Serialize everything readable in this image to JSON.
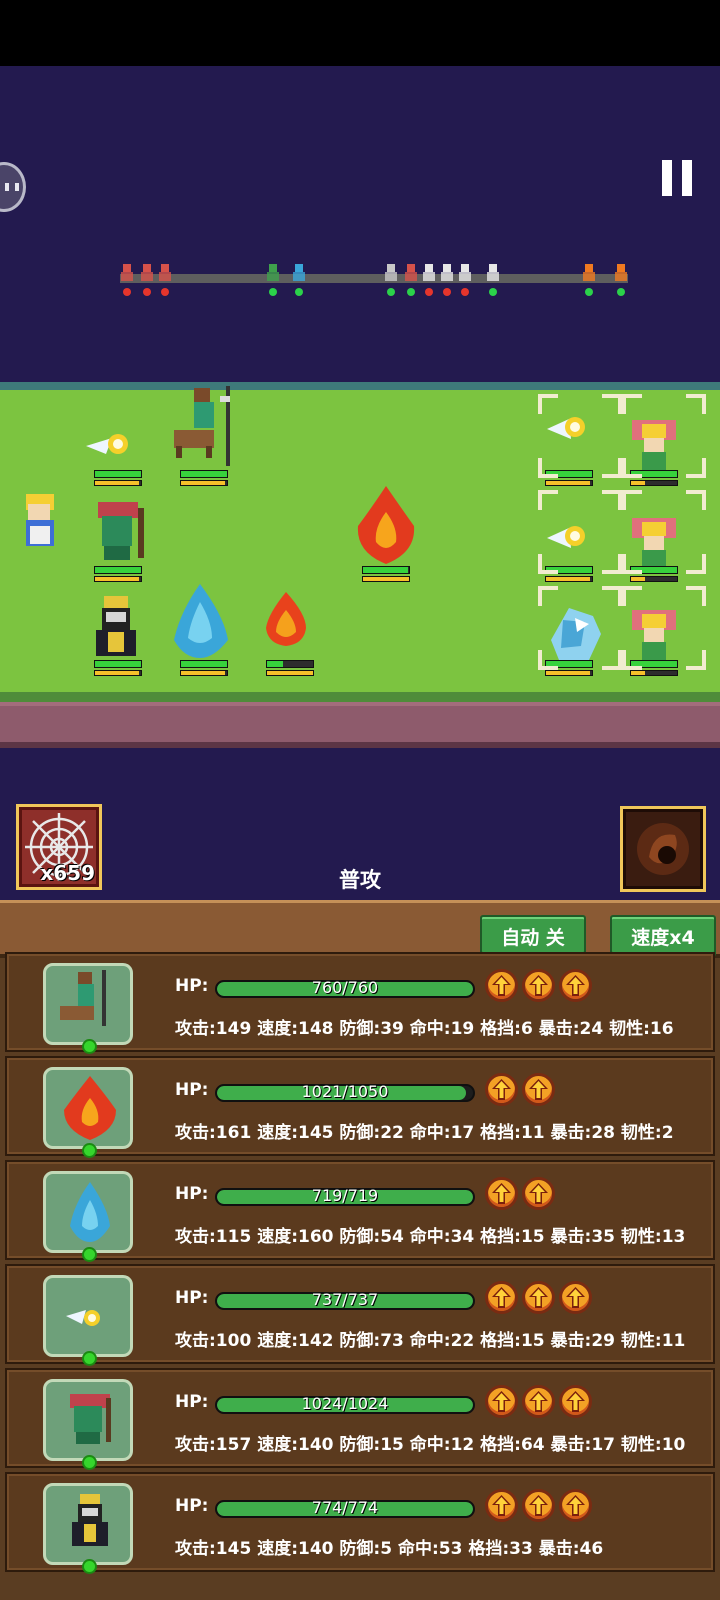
{
  "battle": {
    "skill_count": "x659",
    "attack_label": "普攻",
    "auto_button": "自动 关",
    "speed_button": "速度x4"
  },
  "timeline": {
    "markers": [
      {
        "side": "enemy",
        "color": "#e5352c"
      },
      {
        "side": "enemy",
        "color": "#e5352c"
      },
      {
        "side": "enemy",
        "color": "#e5352c"
      },
      {
        "side": "ally",
        "color": "#2bd24a"
      },
      {
        "side": "ally",
        "color": "#2bd24a"
      },
      {
        "side": "ally",
        "color": "#2bd24a"
      },
      {
        "side": "ally",
        "color": "#2bd24a"
      },
      {
        "side": "enemy",
        "color": "#e5352c"
      },
      {
        "side": "enemy",
        "color": "#e5352c"
      },
      {
        "side": "enemy",
        "color": "#e5352c"
      },
      {
        "side": "ally",
        "color": "#2bd24a"
      },
      {
        "side": "ally",
        "color": "#2bd24a"
      },
      {
        "side": "ally",
        "color": "#2bd24a"
      }
    ]
  },
  "field_units": [
    {
      "name": "wizard-hero",
      "icon": "wizard-icon",
      "hp": null,
      "energy": null
    },
    {
      "name": "fairy-ally",
      "icon": "fairy-icon",
      "hp": 1.0,
      "energy": 0.95
    },
    {
      "name": "centaur-spearman",
      "icon": "centaur-icon",
      "hp": 1.0,
      "energy": 0.95
    },
    {
      "name": "plant-knight",
      "icon": "plant-knight-icon",
      "hp": 1.0,
      "energy": 0.95
    },
    {
      "name": "fire-elemental",
      "icon": "fire-elemental-icon",
      "hp": 0.97,
      "energy": 1.0
    },
    {
      "name": "dark-knight",
      "icon": "dark-knight-icon",
      "hp": 1.0,
      "energy": 0.95
    },
    {
      "name": "water-elemental",
      "icon": "water-elemental-icon",
      "hp": 1.0,
      "energy": 0.95
    },
    {
      "name": "flame-spirit",
      "icon": "flame-spirit-icon",
      "hp": 0.35,
      "energy": 1.0
    },
    {
      "name": "enemy-wisp-1",
      "icon": "wisp-icon",
      "hp": 1.0,
      "energy": 0.95
    },
    {
      "name": "enemy-dryad-1",
      "icon": "dryad-icon",
      "hp": 1.0,
      "energy": 0.3
    },
    {
      "name": "enemy-wisp-2",
      "icon": "wisp-icon",
      "hp": 1.0,
      "energy": 0.95
    },
    {
      "name": "enemy-dryad-2",
      "icon": "dryad-icon",
      "hp": 1.0,
      "energy": 0.3
    },
    {
      "name": "enemy-ice-wolf",
      "icon": "ice-wolf-icon",
      "hp": 1.0,
      "energy": 0.95
    },
    {
      "name": "enemy-dryad-3",
      "icon": "dryad-icon",
      "hp": 1.0,
      "energy": 0.3
    }
  ],
  "party": [
    {
      "portrait": "centaur-portrait-icon",
      "hp_label": "HP:",
      "hp_text": "760/760",
      "hp_fraction": 1.0,
      "upgrades": 3,
      "stats": "攻击:149 速度:148 防御:39 命中:19 格挡:6 暴击:24 韧性:16"
    },
    {
      "portrait": "fire-elemental-portrait-icon",
      "hp_label": "HP:",
      "hp_text": "1021/1050",
      "hp_fraction": 0.972,
      "upgrades": 2,
      "stats": "攻击:161 速度:145 防御:22 命中:17 格挡:11 暴击:28 韧性:2"
    },
    {
      "portrait": "water-elemental-portrait-icon",
      "hp_label": "HP:",
      "hp_text": "719/719",
      "hp_fraction": 1.0,
      "upgrades": 2,
      "stats": "攻击:115 速度:160 防御:54 命中:34 格挡:15 暴击:35 韧性:13"
    },
    {
      "portrait": "fairy-portrait-icon",
      "hp_label": "HP:",
      "hp_text": "737/737",
      "hp_fraction": 1.0,
      "upgrades": 3,
      "stats": "攻击:100 速度:142 防御:73 命中:22 格挡:15 暴击:29 韧性:11"
    },
    {
      "portrait": "plant-knight-portrait-icon",
      "hp_label": "HP:",
      "hp_text": "1024/1024",
      "hp_fraction": 1.0,
      "upgrades": 3,
      "stats": "攻击:157 速度:140 防御:15 命中:12 格挡:64 暴击:17 韧性:10"
    },
    {
      "portrait": "dark-knight-portrait-icon",
      "hp_label": "HP:",
      "hp_text": "774/774",
      "hp_fraction": 1.0,
      "upgrades": 3,
      "stats": "攻击:145 速度:140 防御:5 命中:53 格挡:33 暴击:46"
    }
  ]
}
